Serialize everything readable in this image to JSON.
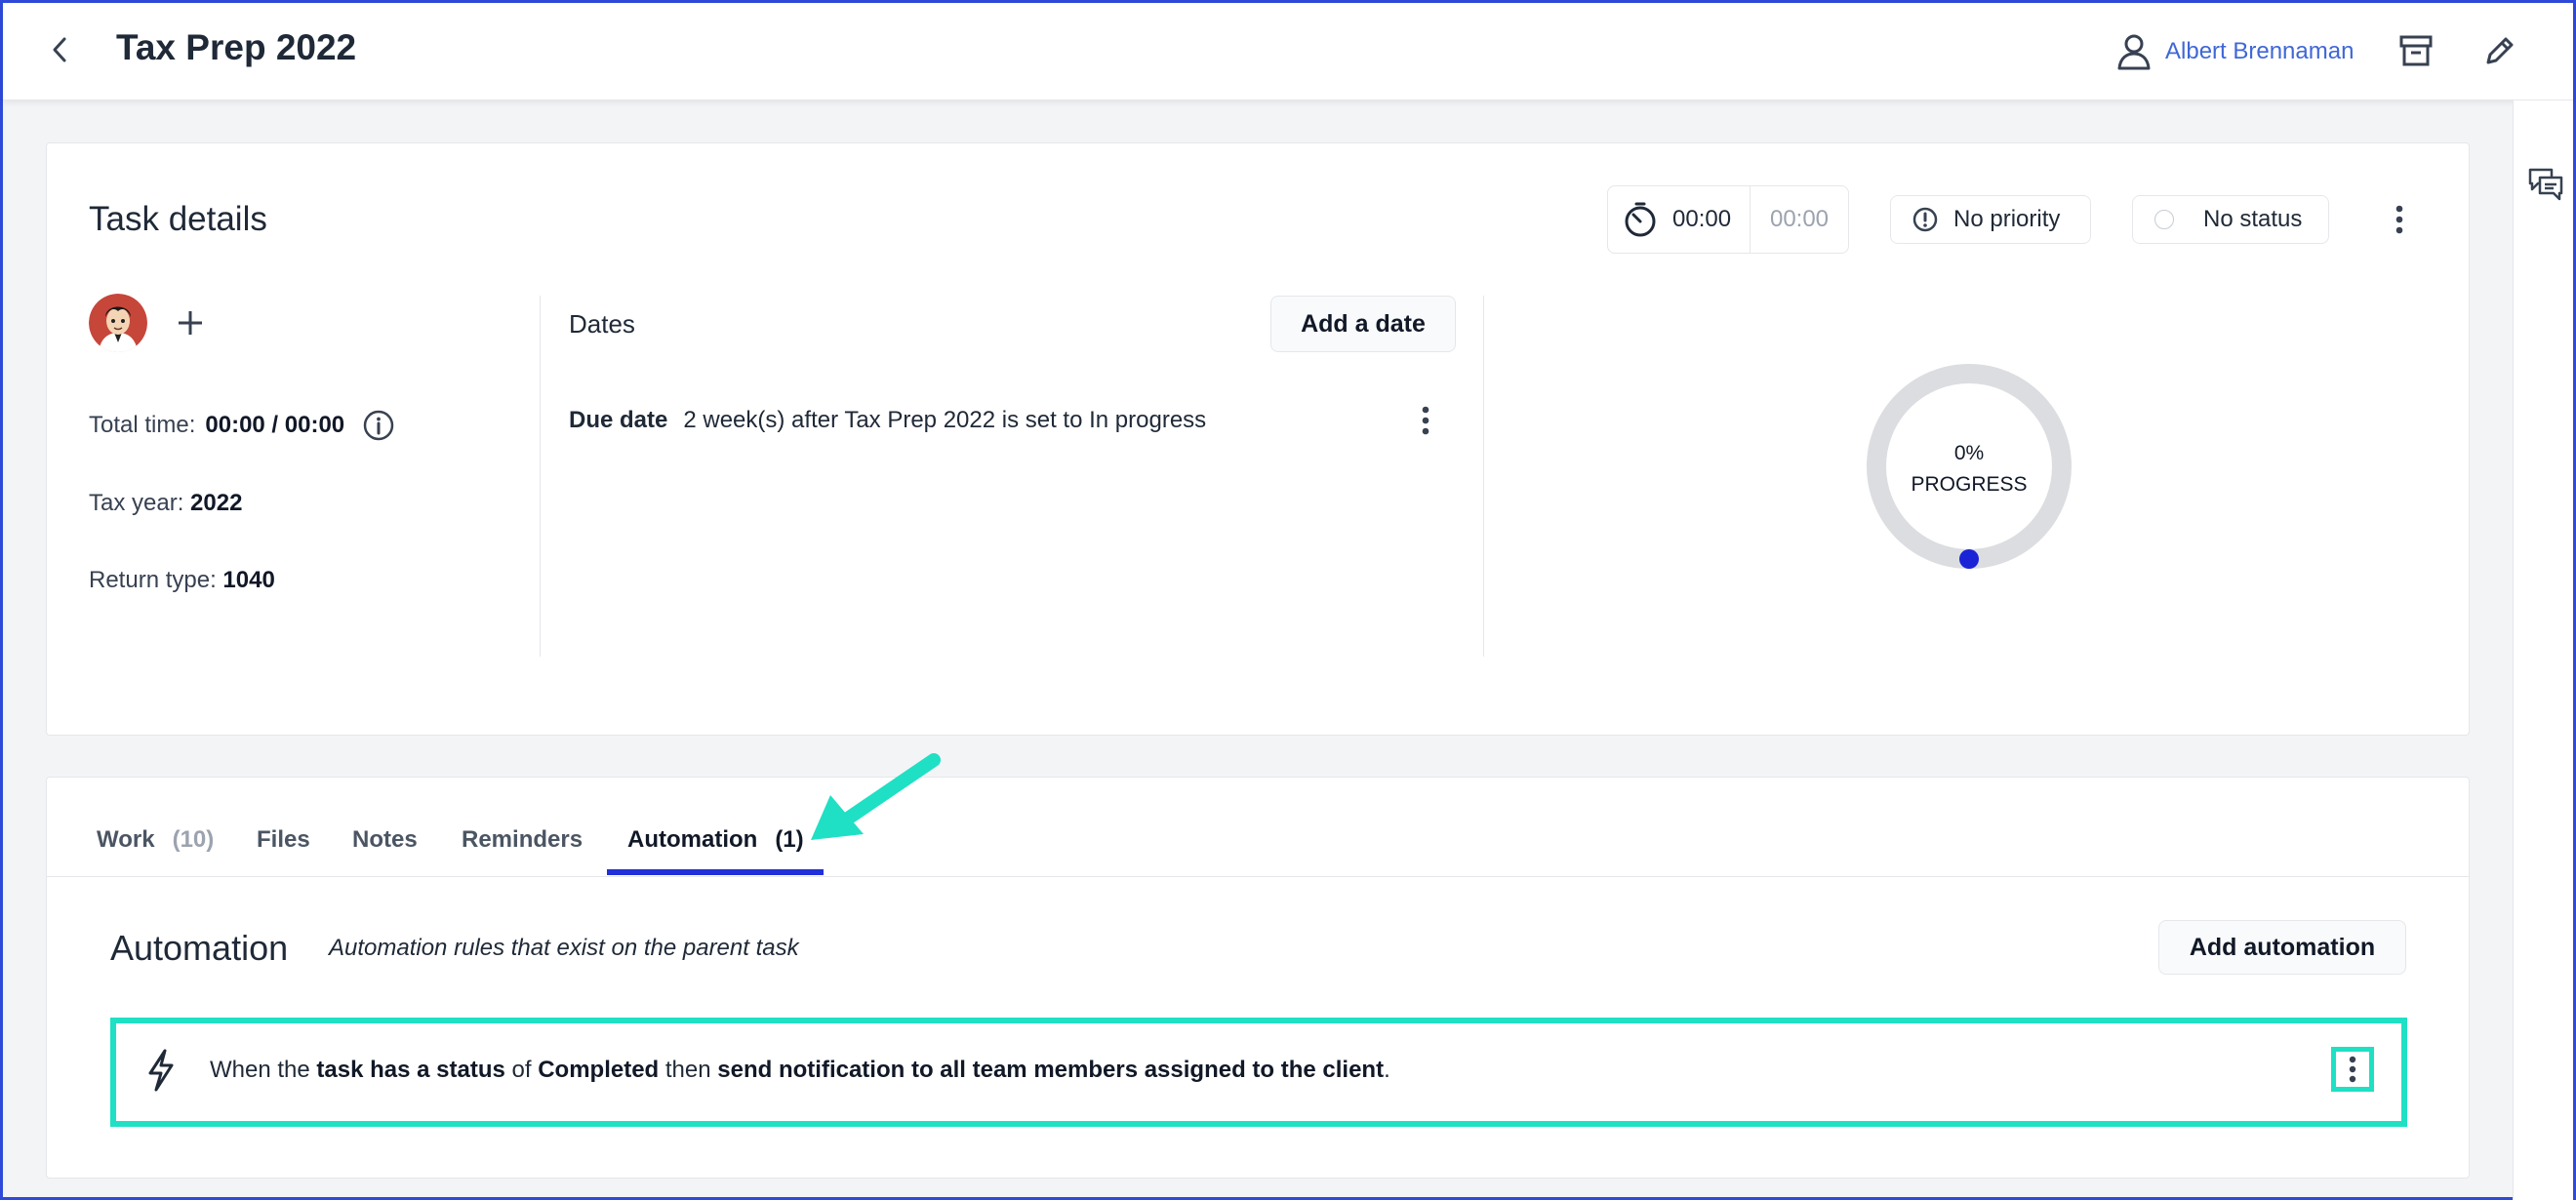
{
  "header": {
    "title": "Tax Prep 2022",
    "user_name": "Albert Brennaman"
  },
  "task": {
    "section_title": "Task details",
    "timer": {
      "elapsed": "00:00",
      "estimate": "00:00"
    },
    "priority_label": "No priority",
    "status_label": "No status",
    "total_time_label": "Total time:",
    "total_time_value": "00:00 / 00:00",
    "tax_year_label": "Tax year:",
    "tax_year_value": "2022",
    "return_type_label": "Return type:",
    "return_type_value": "1040"
  },
  "dates": {
    "label": "Dates",
    "add_button": "Add a date",
    "due_label": "Due date",
    "due_text": "2 week(s) after Tax Prep 2022 is set to In progress"
  },
  "progress": {
    "percent_text": "0%",
    "label": "PROGRESS",
    "value": 0
  },
  "tabs": [
    {
      "label": "Work",
      "count": "(10)"
    },
    {
      "label": "Files",
      "count": ""
    },
    {
      "label": "Notes",
      "count": ""
    },
    {
      "label": "Reminders",
      "count": ""
    },
    {
      "label": "Automation",
      "count": "(1)"
    }
  ],
  "active_tab": "Automation",
  "automation": {
    "title": "Automation",
    "subtitle": "Automation rules that exist on the parent task",
    "add_button": "Add automation",
    "rule": {
      "p1": "When the",
      "b1": "task has a status",
      "p2": "of",
      "b2": "Completed",
      "p3": "then",
      "b3": "send notification to all team members assigned to the client",
      "p4": "."
    }
  },
  "icons": {
    "back": "chevron-left-icon",
    "user": "user-icon",
    "archive": "archive-icon",
    "edit": "pencil-icon",
    "chat": "chat-bubbles-icon",
    "timer": "timer-icon",
    "priority": "exclamation-circle-icon",
    "info": "info-icon",
    "bolt": "lightning-bolt-icon",
    "kebab": "kebab-menu-icon"
  },
  "colors": {
    "accent_blue": "#2130d9",
    "link_blue": "#3f67d6",
    "highlight_teal": "#1fe0c4",
    "progress_dot": "#1a23d6"
  }
}
